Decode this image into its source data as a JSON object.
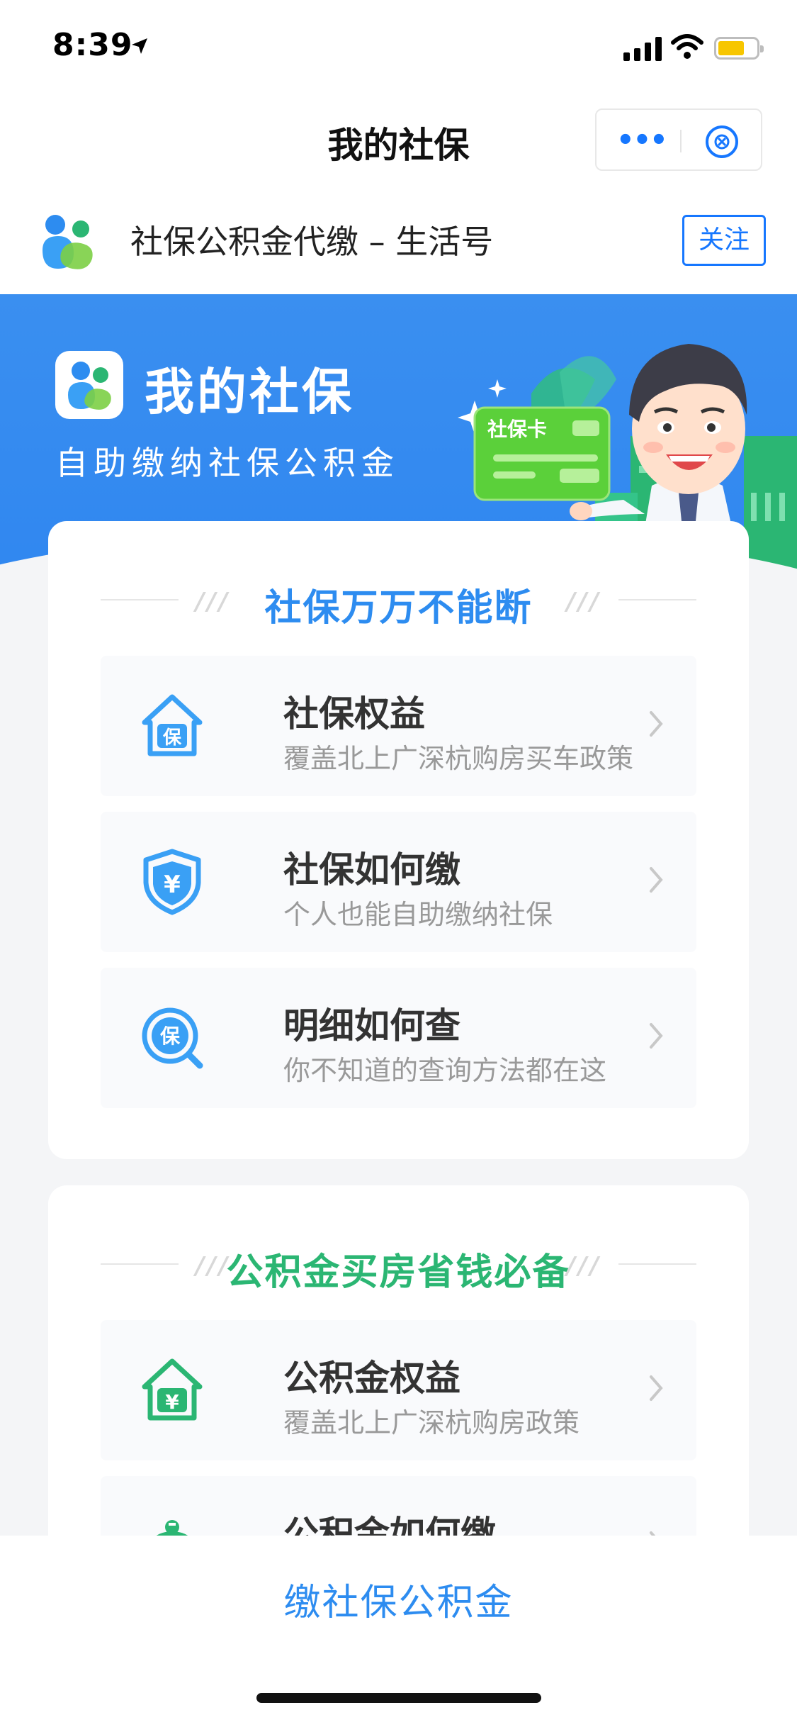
{
  "status_bar": {
    "time": "8:39"
  },
  "nav": {
    "title": "我的社保"
  },
  "life_account": {
    "name": "社保公积金代缴 – 生活号",
    "follow_label": "关注"
  },
  "banner": {
    "title": "我的社保",
    "subtitle": "自助缴纳社保公积金",
    "card_label": "社保卡"
  },
  "section_social": {
    "heading": "社保万万不能断",
    "items": [
      {
        "title": "社保权益",
        "desc": "覆盖北上广深杭购房买车政策",
        "icon": "social-security-house-icon"
      },
      {
        "title": "社保如何缴",
        "desc": "个人也能自助缴纳社保",
        "icon": "yuan-shield-icon"
      },
      {
        "title": "明细如何查",
        "desc": "你不知道的查询方法都在这",
        "icon": "search-bao-icon"
      }
    ]
  },
  "section_fund": {
    "heading": "公积金买房省钱必备",
    "items": [
      {
        "title": "公积金权益",
        "desc": "覆盖北上广深杭购房政策",
        "icon": "yuan-house-icon"
      },
      {
        "title": "公积金如何缴",
        "desc": "",
        "icon": "piggy-bank-icon"
      }
    ]
  },
  "bottom_bar": {
    "button_label": "缴社保公积金"
  },
  "colors": {
    "primary_blue": "#2d8cf0",
    "green": "#2bb673",
    "banner_blue": "#3a8ff0"
  }
}
